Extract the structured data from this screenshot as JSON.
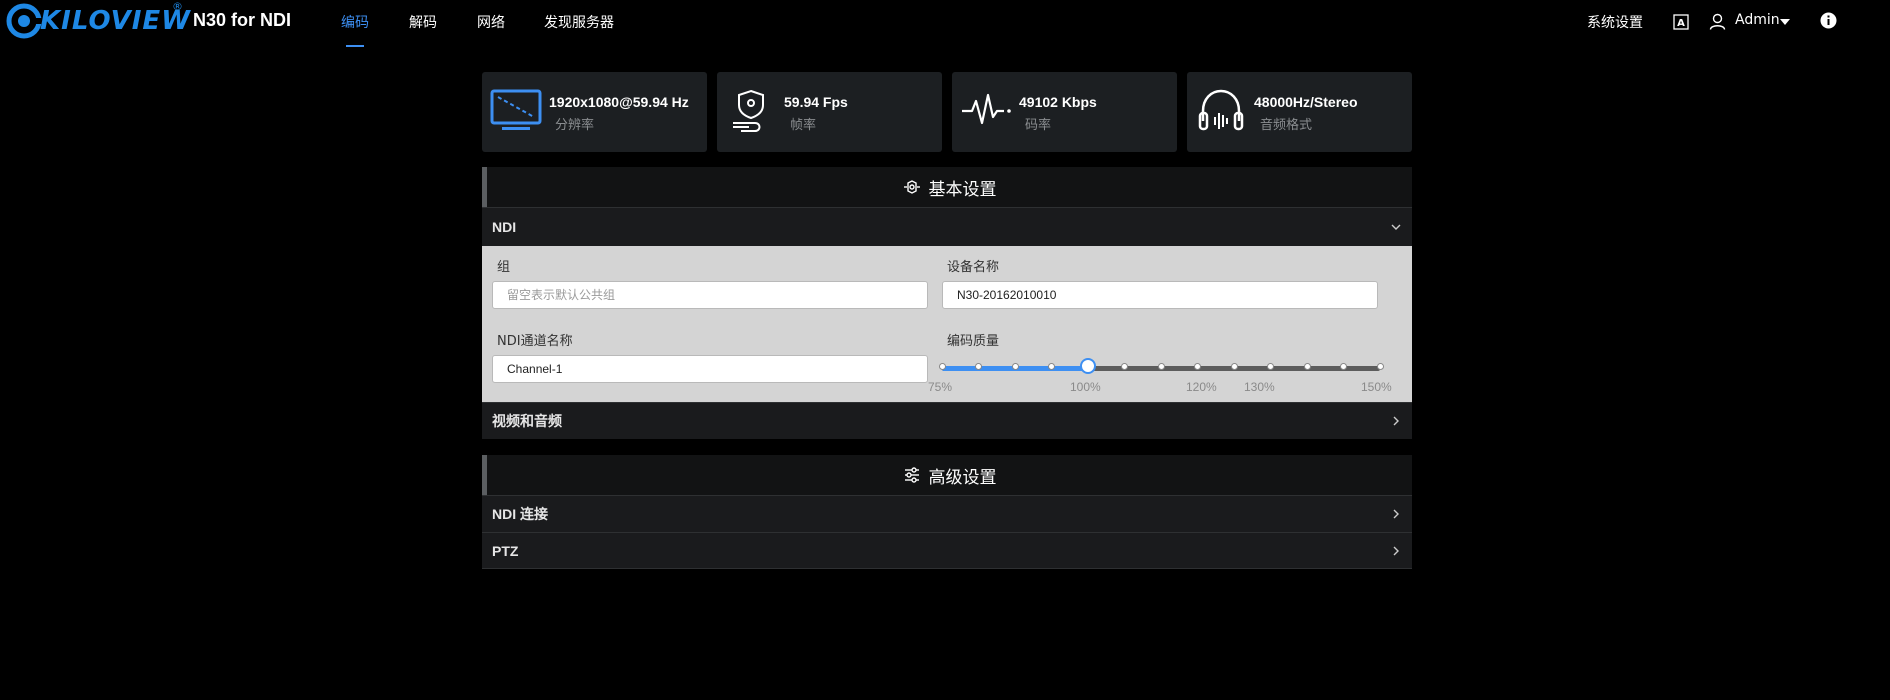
{
  "brand": {
    "logo_text": "KILOVIEW",
    "registered": "®",
    "product": "N30 for NDI",
    "accent_color": "#1e88e5"
  },
  "nav": {
    "tabs": [
      {
        "label": "编码",
        "active": true
      },
      {
        "label": "解码",
        "active": false
      },
      {
        "label": "网络",
        "active": false
      },
      {
        "label": "发现服务器",
        "active": false
      }
    ],
    "system_settings": "系统设置",
    "user": "Admin",
    "active_color": "#3d8ff2"
  },
  "stats": [
    {
      "icon": "monitor-icon",
      "value": "1920x1080@59.94 Hz",
      "label": "分辨率"
    },
    {
      "icon": "frame-rate-icon",
      "value": "59.94 Fps",
      "label": "帧率"
    },
    {
      "icon": "waveform-icon",
      "value": "49102 Kbps",
      "label": "码率"
    },
    {
      "icon": "headphones-icon",
      "value": "48000Hz/Stereo",
      "label": "音频格式"
    }
  ],
  "basic_settings": {
    "title": "基本设置",
    "ndi_section": {
      "label": "NDI",
      "expanded": true,
      "group": {
        "label": "组",
        "value": "",
        "placeholder": "留空表示默认公共组"
      },
      "device_name": {
        "label": "设备名称",
        "value": "N30-20162010010"
      },
      "channel_name": {
        "label": "NDI通道名称",
        "value": "Channel-1"
      },
      "quality": {
        "label": "编码质量",
        "value_percent": 100,
        "min": 75,
        "max": 150,
        "step": 6.25,
        "tick_labels": [
          "75%",
          "100%",
          "120%",
          "130%",
          "150%"
        ]
      }
    },
    "video_audio_label": "视频和音频"
  },
  "advanced_settings": {
    "title": "高级设置",
    "rows": [
      {
        "label": "NDI 连接"
      },
      {
        "label": "PTZ"
      }
    ]
  }
}
